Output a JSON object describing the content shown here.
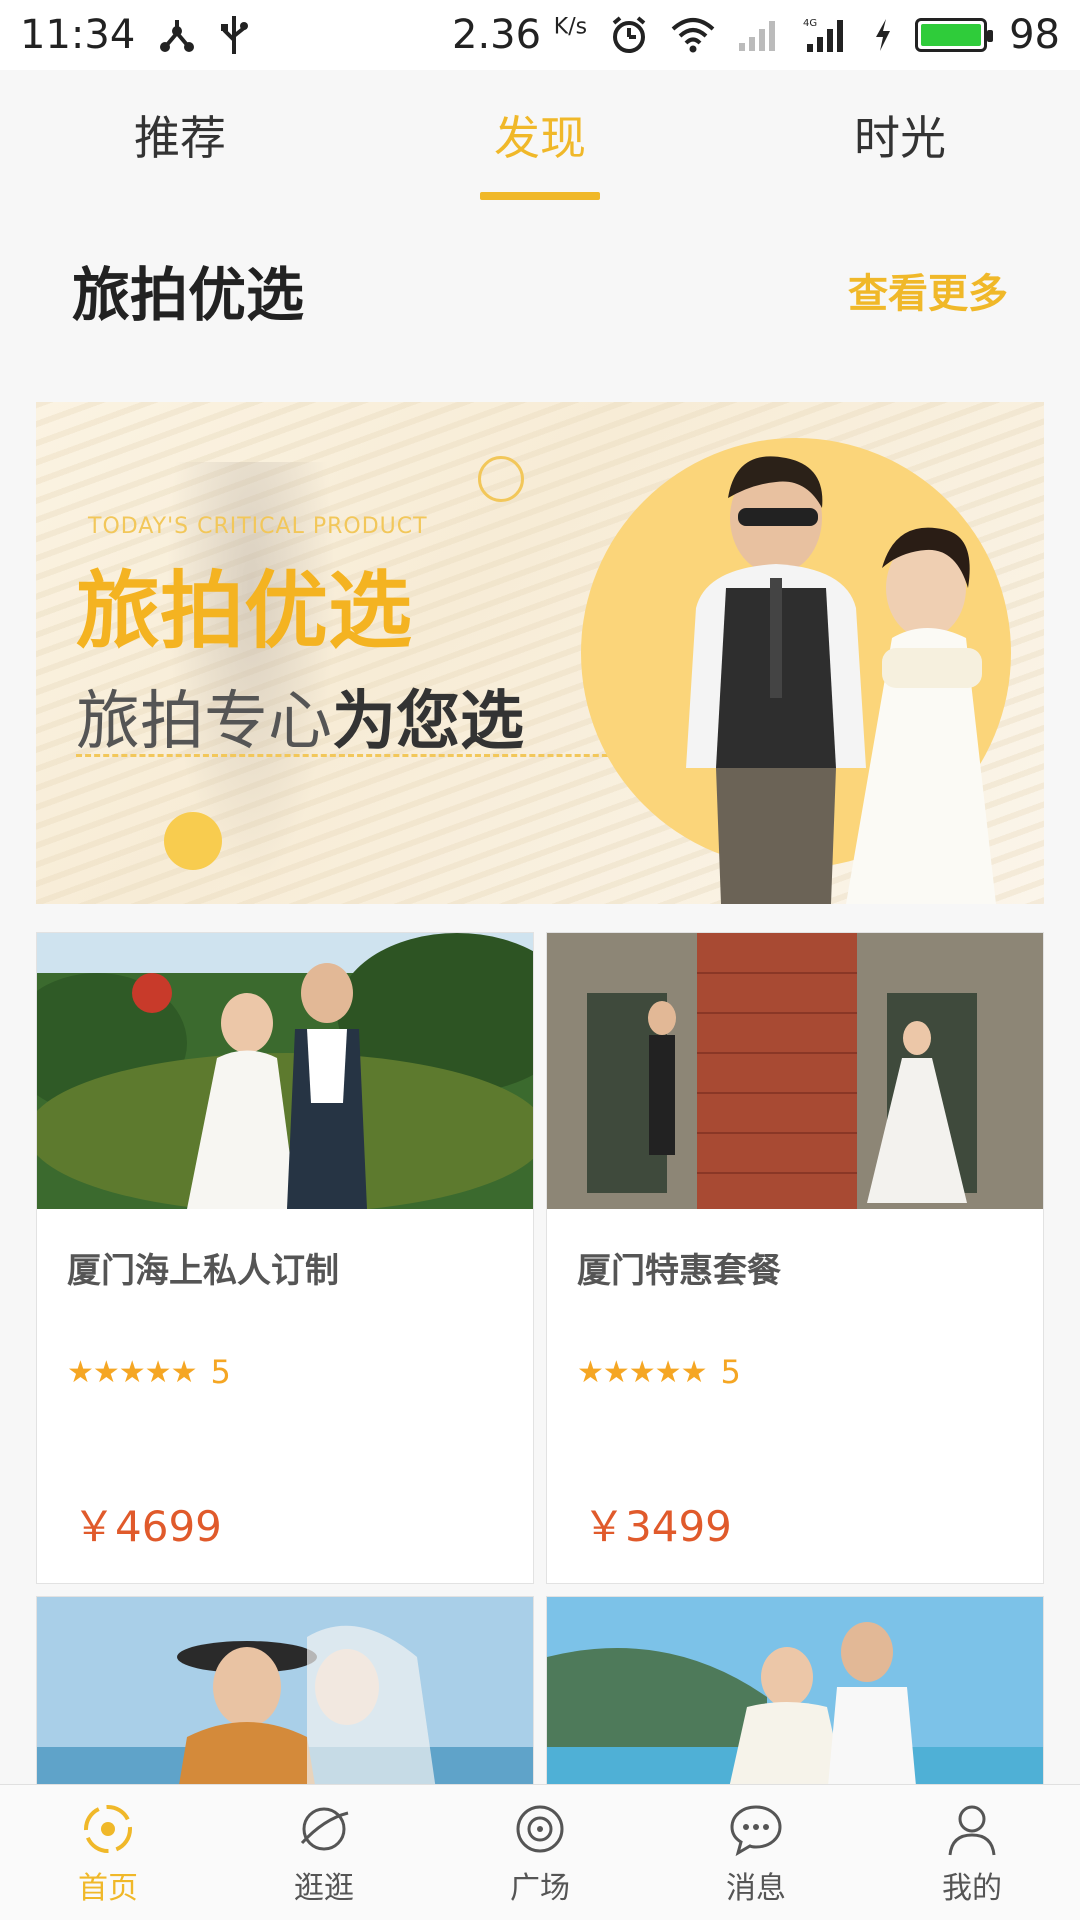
{
  "status_bar": {
    "time": "11:34",
    "speed": "2.36",
    "speed_unit": "K/s",
    "battery": "98",
    "battery_color": "#2fcc3a"
  },
  "tabs": [
    {
      "label": "推荐",
      "active": false
    },
    {
      "label": "发现",
      "active": true
    },
    {
      "label": "时光",
      "active": false
    }
  ],
  "section": {
    "title": "旅拍优选",
    "more": "查看更多"
  },
  "banner": {
    "kicker": "TODAY'S CRITICAL PRODUCT",
    "headline": "旅拍优选",
    "sub_plain": "旅拍专心",
    "sub_bold": "为您选"
  },
  "products": [
    {
      "name": "厦门海上私人订制",
      "rating": "5",
      "price": "￥4699"
    },
    {
      "name": "厦门特惠套餐",
      "rating": "5",
      "price": "￥3499"
    }
  ],
  "bottom_nav": [
    {
      "label": "首页",
      "icon": "home-icon",
      "active": true
    },
    {
      "label": "逛逛",
      "icon": "planet-icon",
      "active": false
    },
    {
      "label": "广场",
      "icon": "square-icon",
      "active": false
    },
    {
      "label": "消息",
      "icon": "message-icon",
      "active": false
    },
    {
      "label": "我的",
      "icon": "profile-icon",
      "active": false
    }
  ],
  "colors": {
    "accent": "#f0b829",
    "price": "#e05a2b",
    "star": "#f5a623"
  }
}
